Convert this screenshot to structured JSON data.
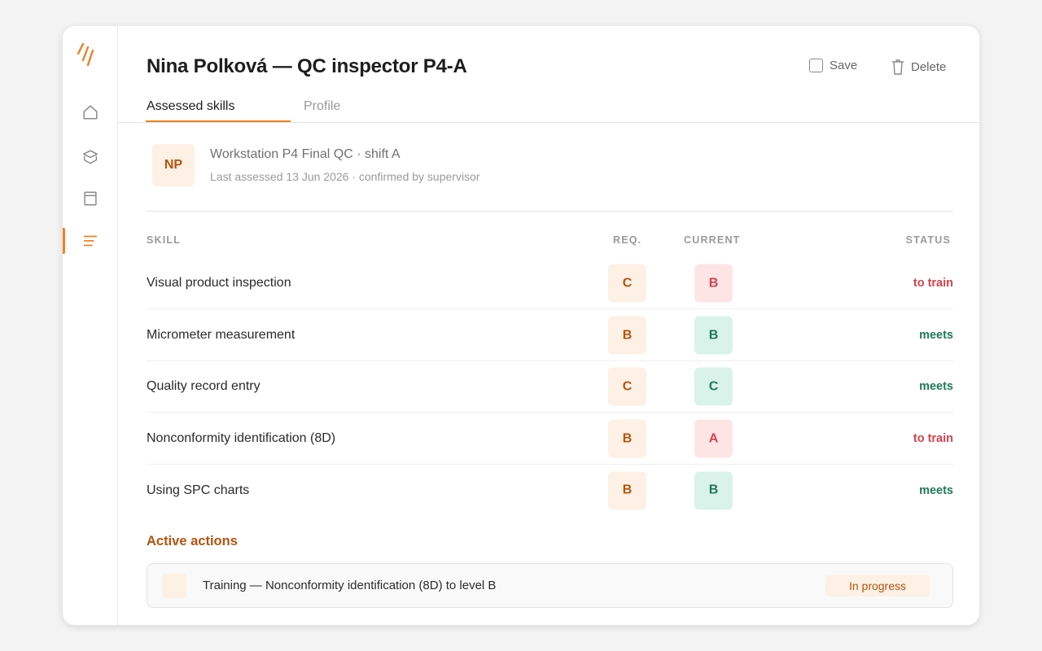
{
  "header": {
    "title": "Nina Polková — QC inspector P4-A",
    "save_label": "Save",
    "delete_label": "Delete"
  },
  "tabs": [
    {
      "label": "Assessed skills",
      "active": true
    },
    {
      "label": "Profile",
      "active": false
    }
  ],
  "sidebar": {
    "items": [
      {
        "icon": "home-icon",
        "active": false
      },
      {
        "icon": "layers-icon",
        "active": false
      },
      {
        "icon": "panel-icon",
        "active": false
      },
      {
        "icon": "list-icon",
        "active": true
      }
    ]
  },
  "person": {
    "initials": "NP",
    "workstation": "Workstation P4 Final QC · shift A",
    "last_assessed": "Last assessed 13 Jun 2026 · confirmed by supervisor"
  },
  "table": {
    "headers": {
      "skill": "SKILL",
      "req": "REQ.",
      "current": "CURRENT",
      "status": "STATUS"
    },
    "rows": [
      {
        "skill": "Visual product inspection",
        "req": "C",
        "current": "B",
        "status": "to train",
        "tone": "red"
      },
      {
        "skill": "Micrometer measurement",
        "req": "B",
        "current": "B",
        "status": "meets",
        "tone": "green"
      },
      {
        "skill": "Quality record entry",
        "req": "C",
        "current": "C",
        "status": "meets",
        "tone": "green"
      },
      {
        "skill": "Nonconformity identification (8D)",
        "req": "B",
        "current": "A",
        "status": "to train",
        "tone": "red"
      },
      {
        "skill": "Using SPC charts",
        "req": "B",
        "current": "B",
        "status": "meets",
        "tone": "green"
      }
    ]
  },
  "actions": {
    "heading": "Active actions",
    "items": [
      {
        "text": "Training — Nonconformity identification (8D) to level B",
        "status": "In progress"
      }
    ]
  },
  "colors": {
    "accent": "#f08020",
    "accent_dark": "#b4540e",
    "red": "#d8404a",
    "green": "#1f7a5a"
  }
}
